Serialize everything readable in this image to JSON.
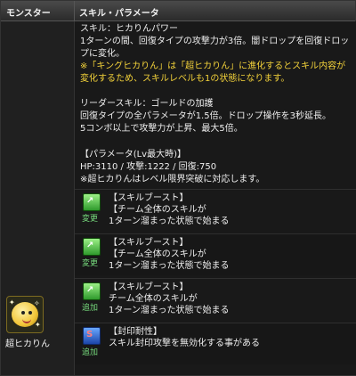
{
  "header": {
    "col1": "モンスター",
    "col2": "スキル・パラメータ"
  },
  "monster": {
    "name": "超ヒカりん"
  },
  "skill": {
    "title": "スキル：ヒカりんパワー",
    "desc1": "1ターンの間、回復タイプの攻撃力が3倍。闇ドロップを回復ドロッ",
    "desc2": "プに変化。",
    "note1": "※「キングヒカりん」は「超ヒカりん」に進化するとスキル内容が",
    "note2": "変化するため、スキルレベルも1の状態になります。"
  },
  "leader": {
    "title": "リーダースキル：ゴールドの加護",
    "desc1": "回復タイプの全パラメータが1.5倍。ドロップ操作を3秒延長。",
    "desc2": "5コンボ以上で攻撃力が上昇、最大5倍。"
  },
  "params": {
    "title": "【パラメータ(Lv最大時)】",
    "stats": "HP:3110 / 攻撃:1222 / 回復:750",
    "note": "※超ヒカりんはレベル限界突破に対応します。"
  },
  "awakenings": [
    {
      "icon": "skill-boost-icon",
      "badge": "変更",
      "line1": "【スキルブースト】",
      "line2": "【チーム全体のスキルが",
      "line3": "1ターン溜まった状態で始まる"
    },
    {
      "icon": "skill-boost-icon",
      "badge": "変更",
      "line1": "【スキルブースト】",
      "line2": "【チーム全体のスキルが",
      "line3": "1ターン溜まった状態で始まる"
    },
    {
      "icon": "skill-boost-icon",
      "badge": "追加",
      "line1": "【スキルブースト】",
      "line2": "チーム全体のスキルが",
      "line3": "1ターン溜まった状態で始まる"
    },
    {
      "icon": "seal-resist-icon",
      "badge": "追加",
      "line1": "【封印耐性】",
      "line2": "スキル封印攻撃を無効化する事がある",
      "line3": ""
    }
  ]
}
